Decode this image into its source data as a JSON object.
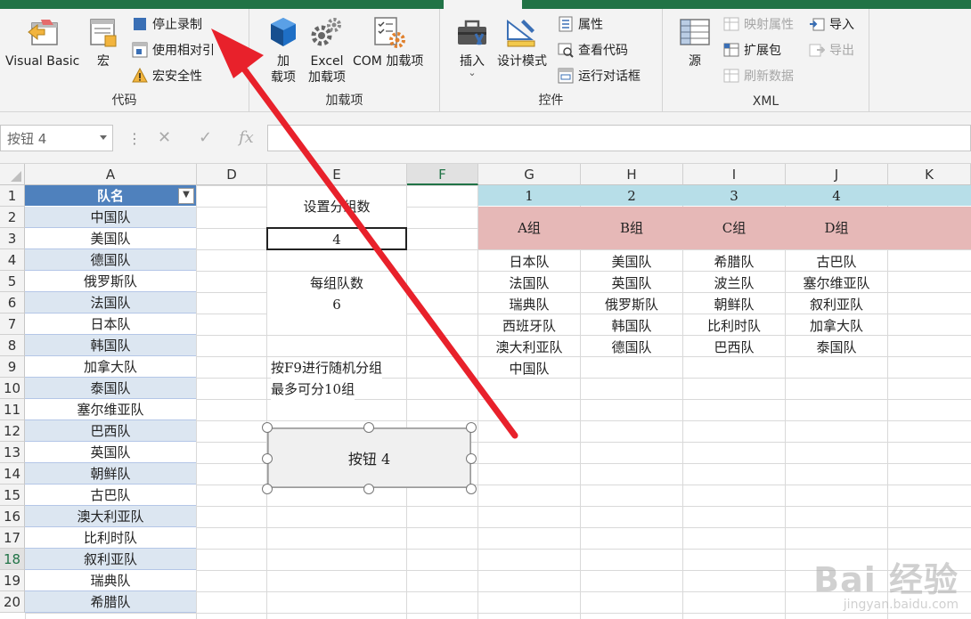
{
  "ribbon": {
    "code": {
      "label": "代码",
      "visual_basic": "Visual Basic",
      "macros": "宏",
      "stop_recording": "停止录制",
      "relative_ref": "使用相对引",
      "macro_security": "宏安全性"
    },
    "addins": {
      "label": "加载项",
      "addins_line1": "加",
      "addins_line2": "载项",
      "excel_addins_line1": "Excel",
      "excel_addins_line2": "加载项",
      "com_addins": "COM 加载项"
    },
    "controls": {
      "label": "控件",
      "insert": "插入",
      "insert_arrow": "⌄",
      "design_mode": "设计模式",
      "properties": "属性",
      "view_code": "查看代码",
      "run_dialog": "运行对话框"
    },
    "xml": {
      "label": "XML",
      "source": "源",
      "map_properties": "映射属性",
      "expansion_packs": "扩展包",
      "refresh_data": "刷新数据",
      "import": "导入",
      "export": "导出"
    }
  },
  "formula_bar": {
    "name_box": "按钮 4",
    "dots": "⋮",
    "cancel": "✕",
    "enter": "✓",
    "fx": "fx"
  },
  "columns": [
    "A",
    "D",
    "E",
    "F",
    "G",
    "H",
    "I",
    "J",
    "K"
  ],
  "rows": [
    "1",
    "2",
    "3",
    "4",
    "5",
    "6",
    "7",
    "8",
    "9",
    "10",
    "11",
    "12",
    "13",
    "14",
    "15",
    "16",
    "17",
    "18",
    "19",
    "20"
  ],
  "table": {
    "header": "队名",
    "teams": [
      "中国队",
      "美国队",
      "德国队",
      "俄罗斯队",
      "法国队",
      "日本队",
      "韩国队",
      "加拿大队",
      "泰国队",
      "塞尔维亚队",
      "巴西队",
      "英国队",
      "朝鲜队",
      "古巴队",
      "澳大利亚队",
      "比利时队",
      "叙利亚队",
      "瑞典队",
      "希腊队"
    ]
  },
  "settings": {
    "group_count_label": "设置分组数",
    "group_count_value": "4",
    "teams_per_group_label": "每组队数",
    "teams_per_group_value": "6",
    "note1": "按F9进行随机分组",
    "note2": "最多可分10组",
    "button_label": "按钮 4"
  },
  "groups": {
    "numbers": [
      "1",
      "2",
      "3",
      "4"
    ],
    "names": [
      "A组",
      "B组",
      "C组",
      "D组"
    ],
    "members": [
      [
        "日本队",
        "法国队",
        "瑞典队",
        "西班牙队",
        "澳大利亚队",
        "中国队"
      ],
      [
        "美国队",
        "英国队",
        "俄罗斯队",
        "韩国队",
        "德国队"
      ],
      [
        "希腊队",
        "波兰队",
        "朝鲜队",
        "比利时队",
        "巴西队"
      ],
      [
        "古巴队",
        "塞尔维亚队",
        "叙利亚队",
        "加拿大队",
        "泰国队"
      ]
    ]
  },
  "watermark": {
    "brand": "Bai 经验",
    "url": "jingyan.baidu.com"
  },
  "colors": {
    "excel_green": "#217346",
    "header_blue": "#4f81bd",
    "band_blue": "#dce6f1",
    "group_number_bg": "#b7dee8",
    "group_name_bg": "#e6b8b7",
    "annotation_arrow": "#e8212b"
  }
}
